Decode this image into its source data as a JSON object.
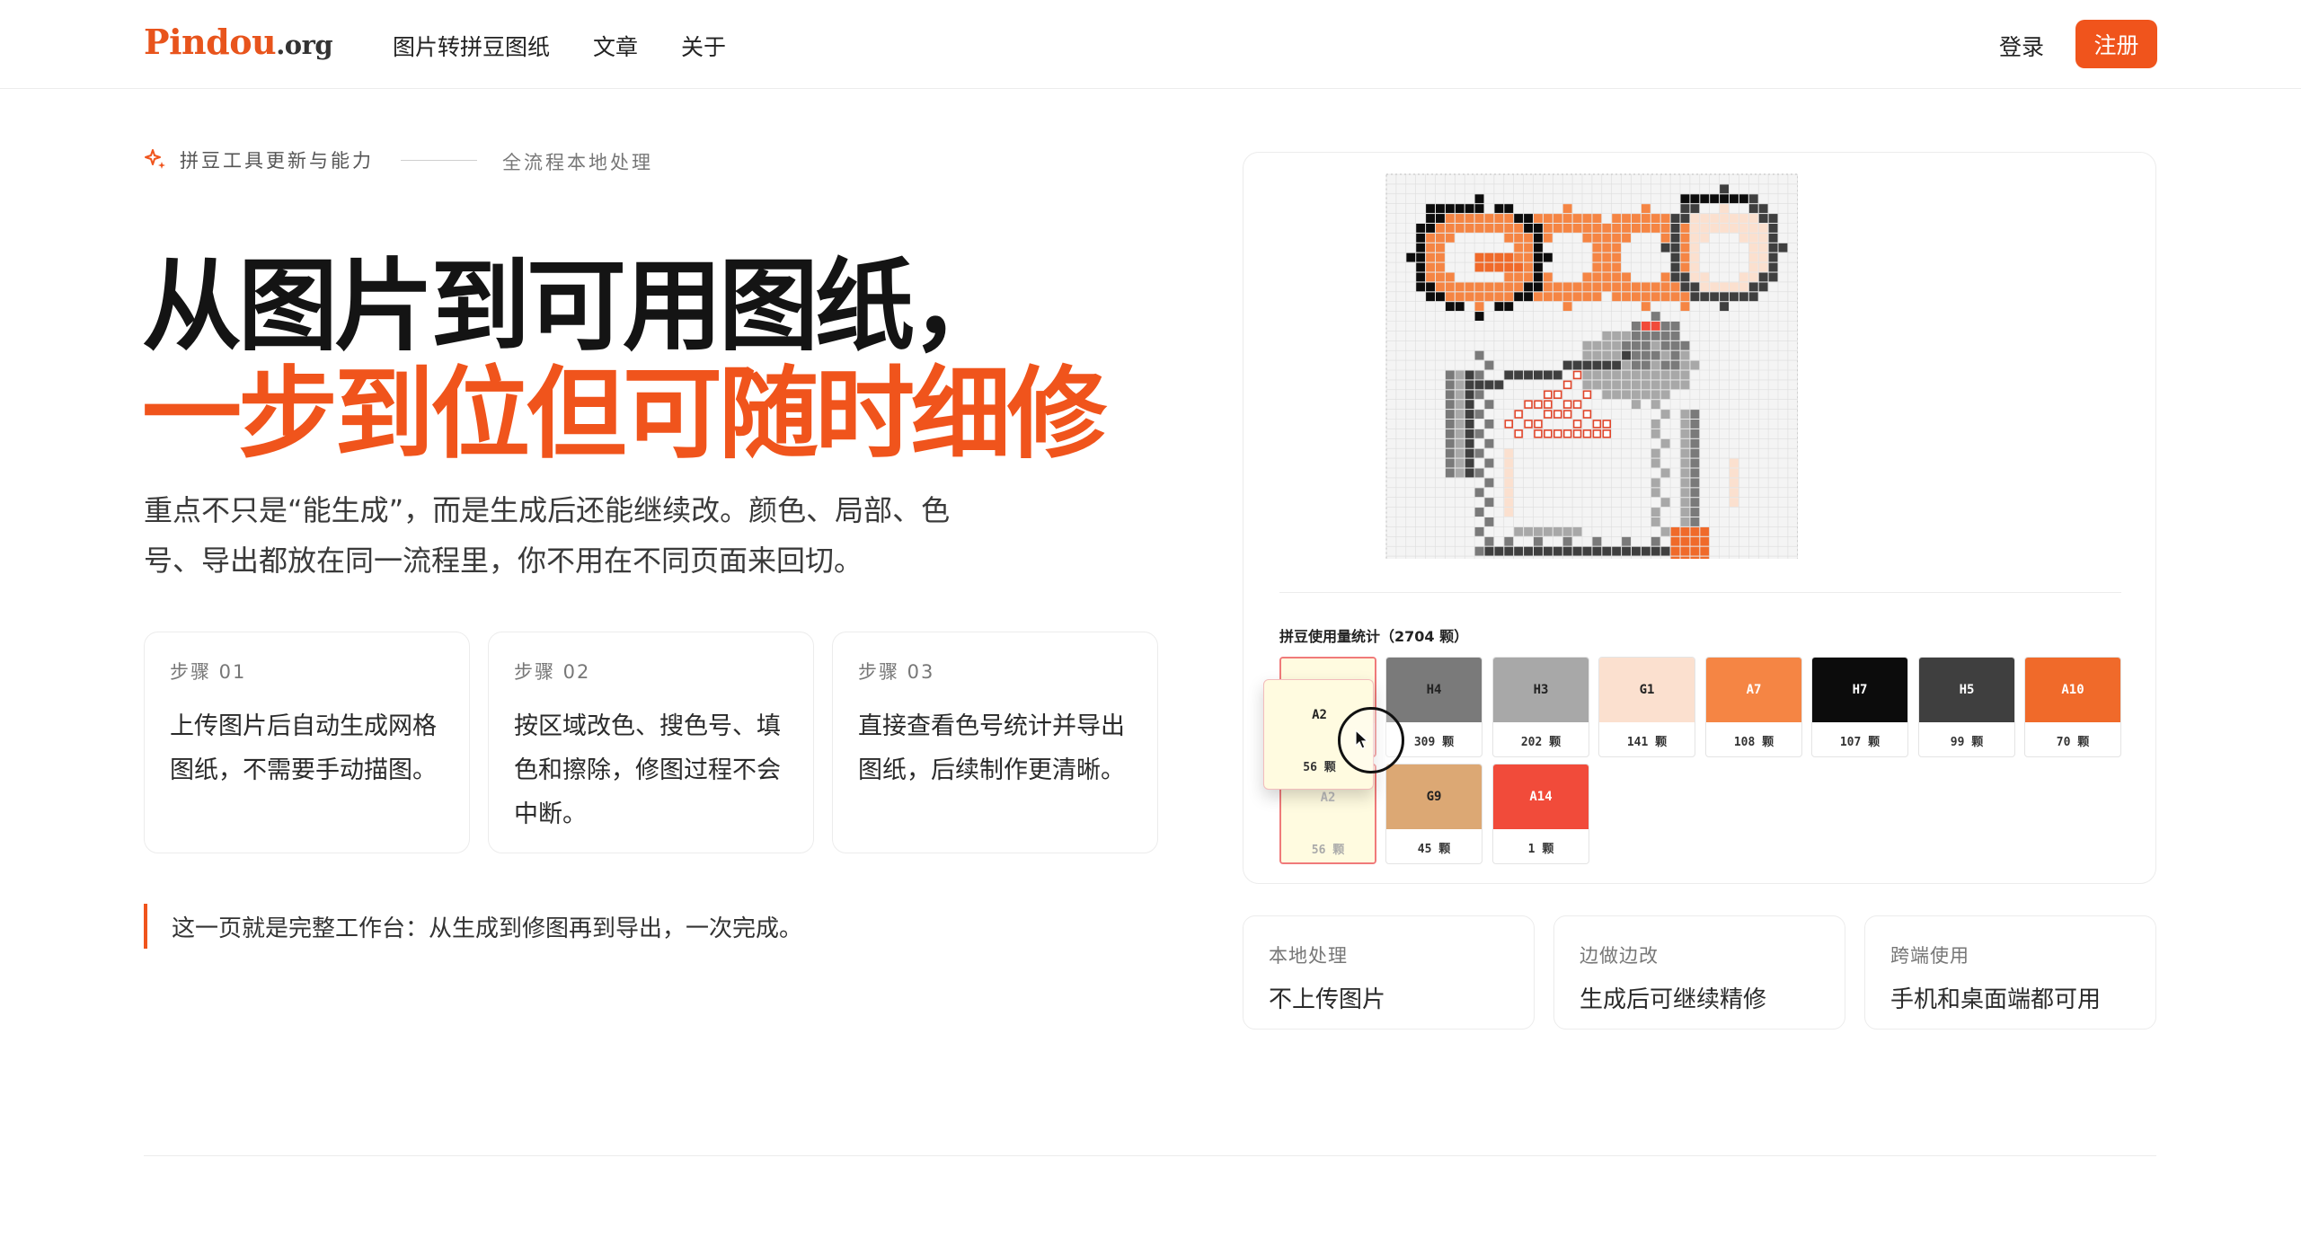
{
  "header": {
    "logo_main": "Pindou",
    "logo_tld": ".org",
    "nav": [
      "图片转拼豆图纸",
      "文章",
      "关于"
    ],
    "login_label": "登录",
    "signup_label": "注册"
  },
  "hero": {
    "eyebrow_icon": "sparkle-icon",
    "eyebrow": "拼豆工具更新与能力",
    "eyebrow_sub": "全流程本地处理",
    "title_line1": "从图片到可用图纸，",
    "title_line2": "一步到位但可随时细修",
    "lead": "重点不只是“能生成”，而是生成后还能继续改。颜色、局部、色号、导出都放在同一流程里，你不用在不同页面来回切。",
    "steps": [
      {
        "label": "步骤 01",
        "text": "上传图片后自动生成网格图纸，不需要手动描图。"
      },
      {
        "label": "步骤 02",
        "text": "按区域改色、搜色号、填色和擦除，修图过程不会中断。"
      },
      {
        "label": "步骤 03",
        "text": "直接查看色号统计并导出图纸，后续制作更清晰。"
      }
    ],
    "note": "这一页就是完整工作台：从生成到修图再到导出，一次完成。"
  },
  "preview": {
    "stats_title": "拼豆使用量统计（2704 颗）",
    "colors": [
      {
        "code": "A2",
        "count": "56 颗",
        "hex": "#fffbe0",
        "text": "#bbbbbb"
      },
      {
        "code": "H4",
        "count": "309 颗",
        "hex": "#7a7a7a",
        "text": "#222222"
      },
      {
        "code": "H3",
        "count": "202 颗",
        "hex": "#a8a8a8",
        "text": "#222222"
      },
      {
        "code": "G1",
        "count": "141 颗",
        "hex": "#fbe0cf",
        "text": "#222222"
      },
      {
        "code": "A7",
        "count": "108 颗",
        "hex": "#f58544",
        "text": "#ffffff"
      },
      {
        "code": "H7",
        "count": "107 颗",
        "hex": "#0c0c0c",
        "text": "#ffffff"
      },
      {
        "code": "H5",
        "count": "99 颗",
        "hex": "#3f3f3f",
        "text": "#ffffff"
      },
      {
        "code": "A10",
        "count": "70 颗",
        "hex": "#f06a2a",
        "text": "#ffffff"
      },
      {
        "code": "A2",
        "count": "56 颗",
        "hex": "#fffbe0",
        "text": "#bbbbbb"
      },
      {
        "code": "G9",
        "count": "45 颗",
        "hex": "#dca874",
        "text": "#222222"
      },
      {
        "code": "A14",
        "count": "1 颗",
        "hex": "#f14b3a",
        "text": "#ffffff"
      }
    ],
    "drag_chip": {
      "code": "A2",
      "count": "56 颗"
    }
  },
  "features": [
    {
      "label": "本地处理",
      "text": "不上传图片"
    },
    {
      "label": "边做边改",
      "text": "生成后可继续精修"
    },
    {
      "label": "跨端使用",
      "text": "手机和桌面端都可用"
    }
  ]
}
